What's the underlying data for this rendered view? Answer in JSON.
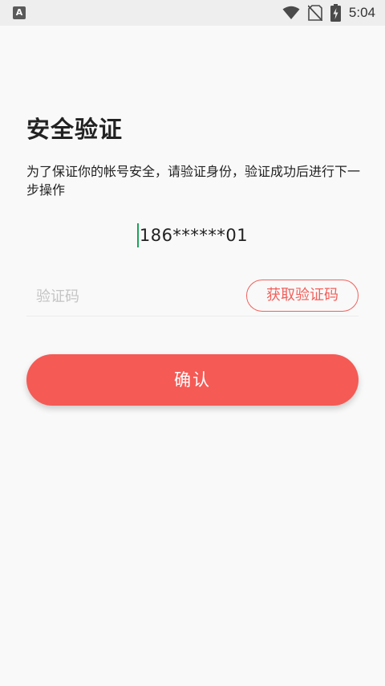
{
  "status_bar": {
    "time": "5:04",
    "app_icon_letter": "A",
    "icons": [
      "wifi-icon",
      "no-sim-icon",
      "battery-charging-icon"
    ]
  },
  "page": {
    "title": "安全验证",
    "description": "为了保证你的帐号安全，请验证身份，验证成功后进行下一步操作",
    "phone": "186******01"
  },
  "code_field": {
    "placeholder": "验证码",
    "value": "",
    "get_code_label": "获取验证码"
  },
  "confirm_label": "确认",
  "colors": {
    "accent": "#f55a55",
    "outline": "#f2605b",
    "cursor": "#1aa25a",
    "background": "#f9f9f9"
  }
}
